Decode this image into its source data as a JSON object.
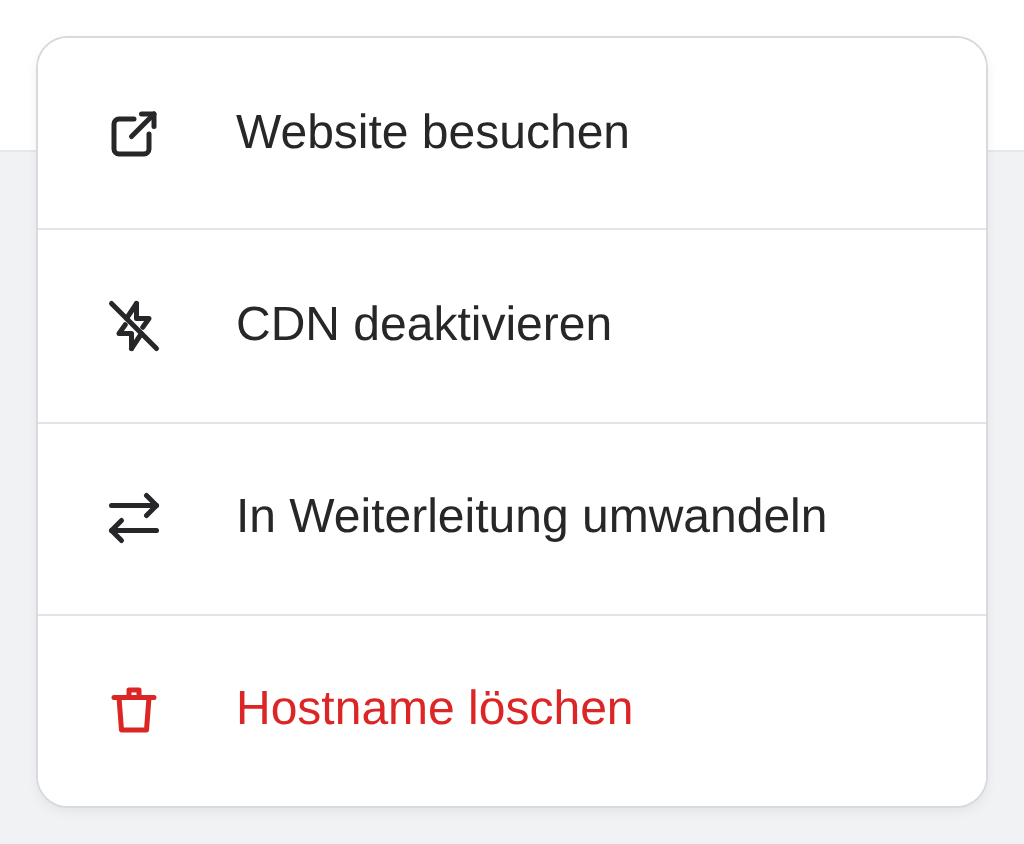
{
  "menu": {
    "items": [
      {
        "label": "Website besuchen",
        "kind": "default"
      },
      {
        "label": "CDN deaktivieren",
        "kind": "default"
      },
      {
        "label": "In Weiterleitung umwandeln",
        "kind": "default"
      },
      {
        "label": "Hostname löschen",
        "kind": "danger"
      }
    ]
  }
}
